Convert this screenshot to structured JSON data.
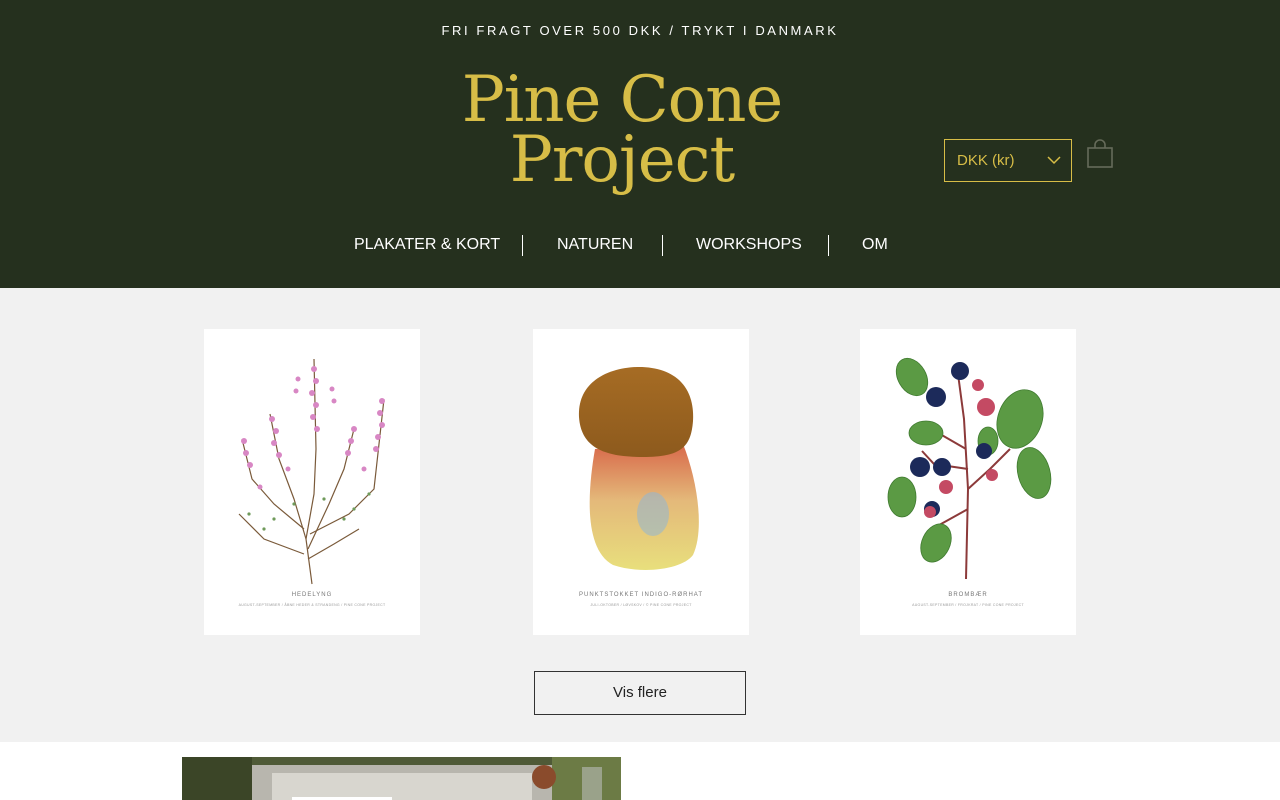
{
  "header": {
    "promo_text": "FRI FRAGT OVER 500 DKK / TRYKT I DANMARK",
    "logo_line1": "Pine Cone",
    "logo_line2": "Project",
    "currency_selected": "DKK (kr)",
    "cart_icon": "shopping-bag-icon"
  },
  "nav": {
    "items": [
      {
        "label": "PLAKATER & KORT"
      },
      {
        "label": "NATUREN"
      },
      {
        "label": "WORKSHOPS"
      },
      {
        "label": "OM"
      }
    ]
  },
  "products": [
    {
      "title": "HEDELYNG",
      "subtitle": "AUGUST-SEPTEMBER / ÅBNE HEDER & STRANDENG / PINE CONE PROJECT",
      "image": "heather-illustration"
    },
    {
      "title": "PUNKTSTOKKET INDIGO-RØRHAT",
      "subtitle": "JULI-OKTOBER / LØVSKOV / © PINE CONE PROJECT",
      "image": "mushroom-illustration"
    },
    {
      "title": "BROMBÆR",
      "subtitle": "AUGUST-SEPTEMBER / FROJKRAT / PINE CONE PROJECT",
      "image": "blackberry-illustration"
    }
  ],
  "more_button": "Vis flere",
  "colors": {
    "header_bg": "#25301e",
    "accent_gold": "#d7bd47",
    "page_bg": "#f1f1f1"
  }
}
